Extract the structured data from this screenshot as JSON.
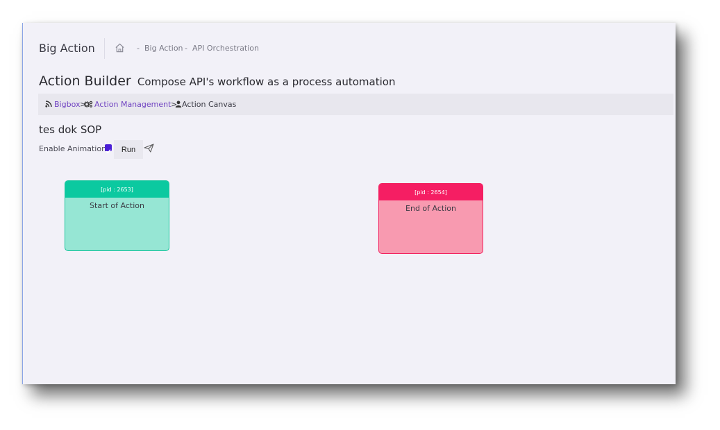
{
  "header": {
    "app_title": "Big Action",
    "breadcrumb": [
      "Big Action",
      "API Orchestration"
    ],
    "separator": "-"
  },
  "page": {
    "title": "Action Builder",
    "subtitle": "Compose API's workflow as a process automation"
  },
  "breadcrumb_bar": {
    "items": [
      {
        "label": "Bigbox",
        "icon": "rss-icon",
        "link": true
      },
      {
        "label": "Action Management",
        "icon": "cogs-icon",
        "link": true
      },
      {
        "label": "Action Canvas",
        "icon": "user-icon",
        "link": false
      }
    ],
    "separator": ">"
  },
  "workflow": {
    "name": "tes dok SOP",
    "animation_label": "Enable Animation",
    "animation_enabled": true,
    "run_label": "Run"
  },
  "nodes": [
    {
      "pid": "[pid : 2653]",
      "label": "Start of Action",
      "color": "#0bc9a0"
    },
    {
      "pid": "[pid : 2654]",
      "label": "End of Action",
      "color": "#f51e63"
    }
  ],
  "colors": {
    "accent": "#6f42c1",
    "background": "#f2f1f8"
  }
}
